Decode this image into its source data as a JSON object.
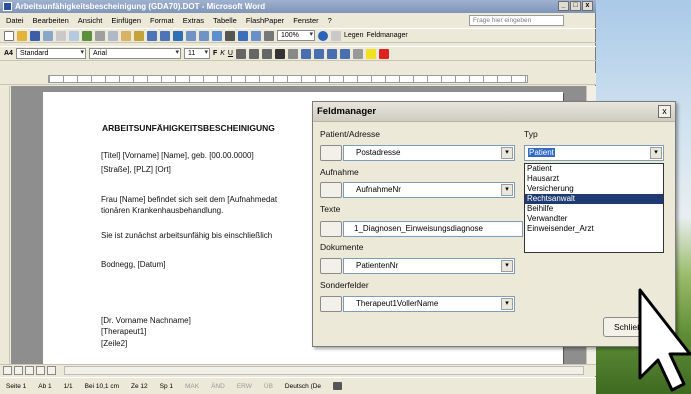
{
  "window": {
    "title": "Arbeitsunfähigkeitsbescheinigung (GDA70).DOT - Microsoft Word",
    "controls": [
      "_",
      "□",
      "x"
    ]
  },
  "menu": {
    "items": [
      "Datei",
      "Bearbeiten",
      "Ansicht",
      "Einfügen",
      "Format",
      "Extras",
      "Tabelle",
      "FlashPaper",
      "Fenster",
      "?"
    ],
    "help_placeholder": "Frage hier eingeben"
  },
  "toolbar": {
    "zoom": "100%",
    "legen_label": "Legen",
    "feldmanager_label": "Feldmanager",
    "style": "Standard",
    "font": "Arial",
    "size": "11",
    "bold": "F",
    "italic": "K",
    "underline": "U",
    "style_icon": "A4"
  },
  "document": {
    "heading": "ARBEITSUNFÄHIGKEITSBESCHEINIGUNG",
    "line1": "[Titel] [Vorname] [Name], geb. [00.00.0000]",
    "line2": "[Straße], [PLZ] [Ort]",
    "para1a": "Frau [Name] befindet sich seit dem [Aufnahmedat",
    "para1b": "tionären Krankenhausbehandlung.",
    "para2": "Sie ist zunächst arbeitsunfähig bis einschließlich",
    "place_date": "Bodnegg, [Datum]",
    "sig1": "[Dr. Vorname Nachname]",
    "sig2": "[Therapeut1]",
    "sig3": "[Zeile2]"
  },
  "status": {
    "seite": "Seite 1",
    "ab": "Ab 1",
    "page_of": "1/1",
    "bei": "Bei 10,1 cm",
    "ze": "Ze 12",
    "sp": "Sp 1",
    "mak": "MAK",
    "aend": "ÄND",
    "erw": "ERW",
    "ub": "ÜB",
    "lang": "Deutsch (De"
  },
  "dialog": {
    "title": "Feldmanager",
    "close": "x",
    "sections": {
      "patient_label": "Patient/Adresse",
      "patient_value": "Postadresse",
      "aufnahme_label": "Aufnahme",
      "aufnahme_value": "AufnahmeNr",
      "texte_label": "Texte",
      "texte_value": "1_Diagnosen_Einweisungsdiagnose",
      "dokumente_label": "Dokumente",
      "dokumente_value": "PatientenNr",
      "sonder_label": "Sonderfelder",
      "sonder_value": "Therapeut1VollerName"
    },
    "typ": {
      "label": "Typ",
      "selected": "Patient",
      "options": [
        "Patient",
        "Hausarzt",
        "Versicherung",
        "Rechtsanwalt",
        "Beihilfe",
        "Verwandter",
        "Einweisender_Arzt"
      ],
      "highlighted": "Rechtsanwalt"
    },
    "close_button": "Schließen"
  }
}
